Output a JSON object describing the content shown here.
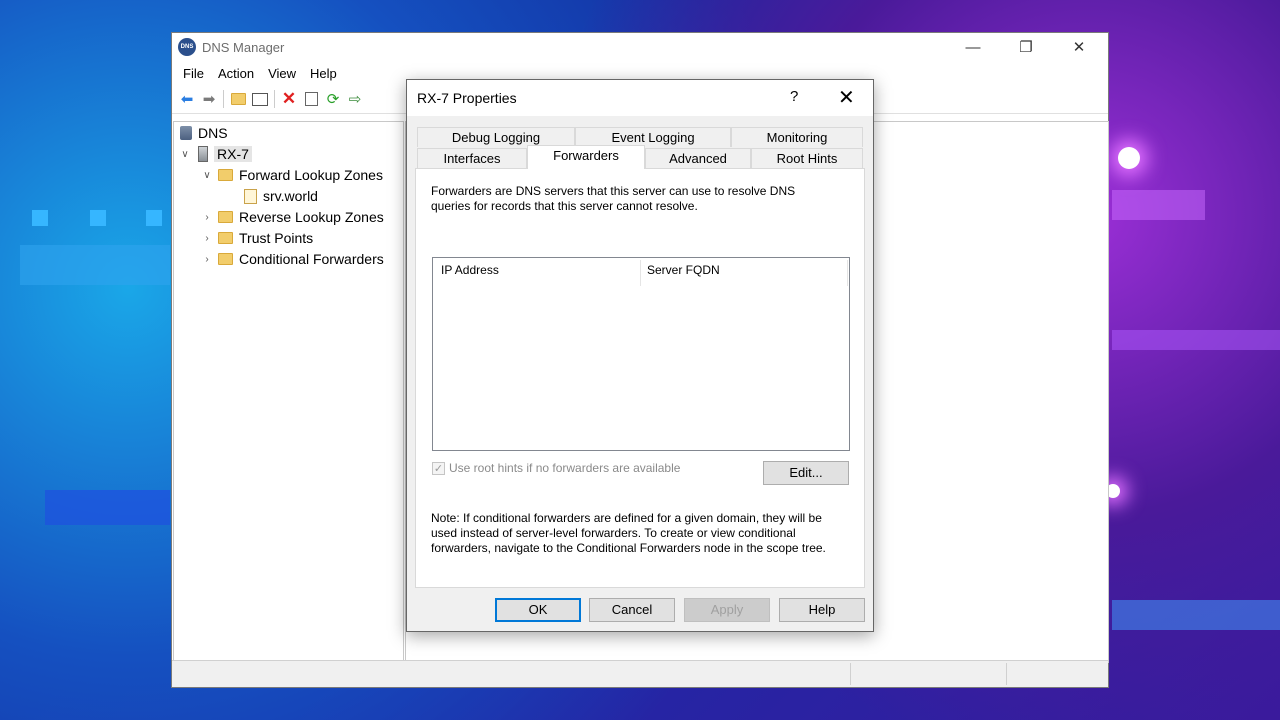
{
  "window": {
    "title": "DNS Manager",
    "app_icon_text": "DNS",
    "controls": {
      "minimize": "—",
      "maximize": "❐",
      "close": "✕"
    }
  },
  "menu": [
    "File",
    "Action",
    "View",
    "Help"
  ],
  "toolbar_icons": [
    "back-icon",
    "forward-icon",
    "up-folder-icon",
    "show-hide-tree-icon",
    "delete-icon",
    "properties-icon",
    "refresh-icon",
    "export-list-icon"
  ],
  "tree": {
    "root": "DNS",
    "server": "RX-7",
    "items": [
      {
        "label": "Forward Lookup Zones",
        "expanded": true
      },
      {
        "label": "srv.world"
      },
      {
        "label": "Reverse Lookup Zones",
        "expanded": false
      },
      {
        "label": "Trust Points",
        "expanded": false
      },
      {
        "label": "Conditional Forwarders",
        "expanded": false
      }
    ]
  },
  "dialog": {
    "title": "RX-7 Properties",
    "help": "?",
    "close": "✕",
    "tabs_row1": [
      "Debug Logging",
      "Event Logging",
      "Monitoring"
    ],
    "tabs_row2": [
      "Interfaces",
      "Forwarders",
      "Advanced",
      "Root Hints"
    ],
    "active_tab": "Forwarders",
    "description": "Forwarders are DNS servers that this server can use to resolve DNS queries for records that this server cannot resolve.",
    "list_columns": [
      "IP Address",
      "Server FQDN"
    ],
    "list_rows": [],
    "use_root_hints": {
      "label": "Use root hints if no forwarders are available",
      "checked": true,
      "enabled": false
    },
    "edit_button": "Edit...",
    "note": "Note: If conditional forwarders are defined for a given domain, they will be used instead of server-level forwarders.  To create or view conditional forwarders, navigate to the Conditional Forwarders node in the scope tree.",
    "buttons": {
      "ok": "OK",
      "cancel": "Cancel",
      "apply": "Apply",
      "help": "Help"
    }
  }
}
